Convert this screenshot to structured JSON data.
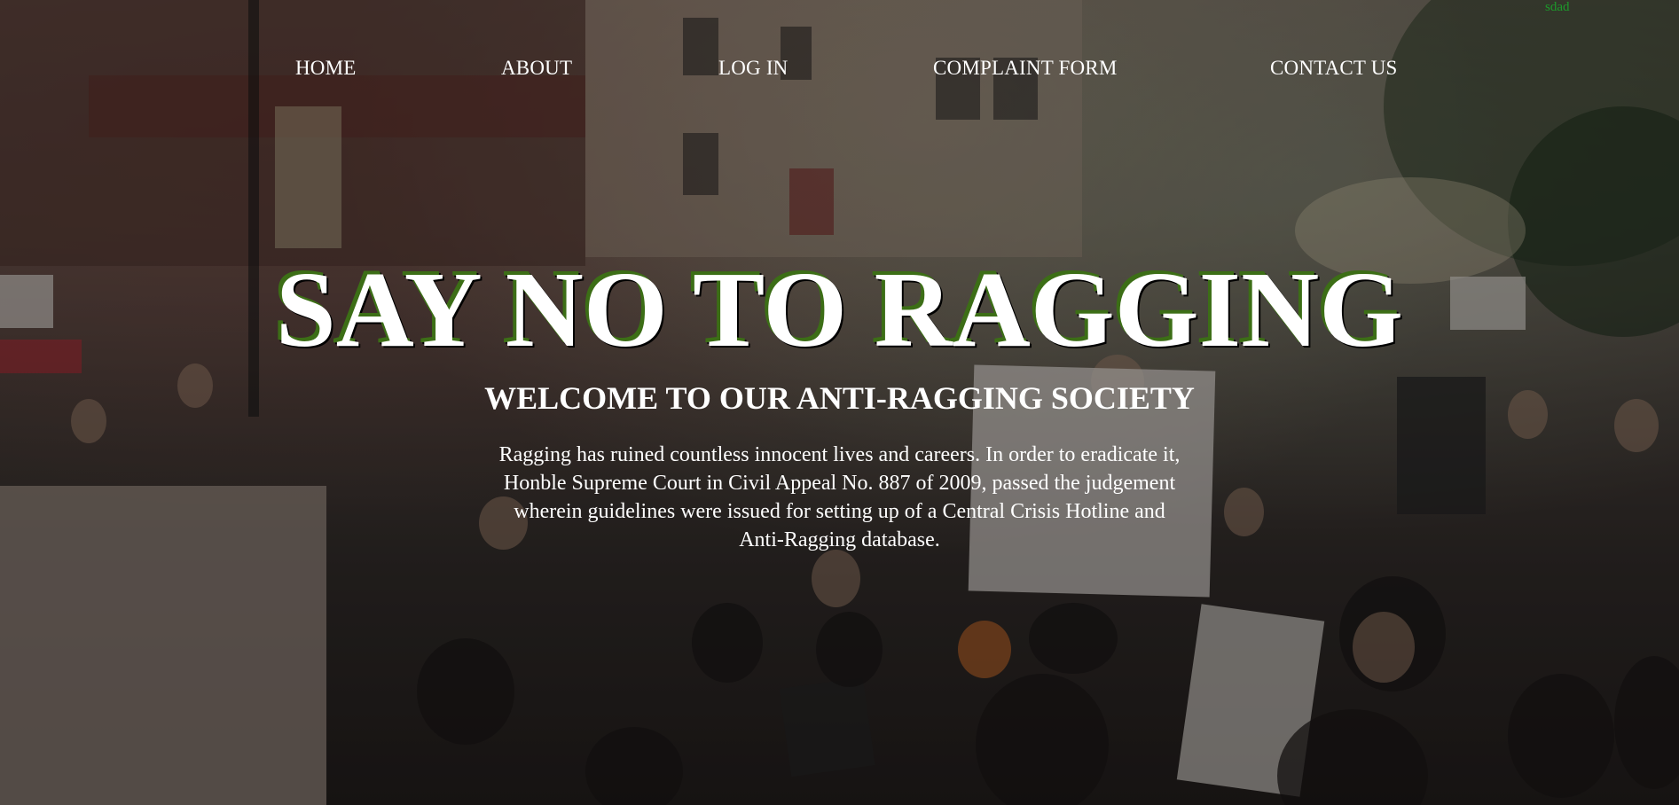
{
  "nav": {
    "items": [
      {
        "label": "HOME"
      },
      {
        "label": "ABOUT"
      },
      {
        "label": "LOG IN"
      },
      {
        "label": "COMPLAINT FORM"
      },
      {
        "label": "CONTACT US"
      }
    ]
  },
  "corner_text": "sdad",
  "hero": {
    "title": "SAY NO TO RAGGING",
    "subtitle": "WELCOME TO OUR ANTI-RAGGING SOCIETY",
    "intro": "Ragging has ruined countless innocent lives and careers. In order to eradicate it, Honble Supreme Court in Civil Appeal No. 887 of 2009, passed the judgement wherein guidelines were issued for setting up of a Central Crisis Hotline and Anti-Ragging database."
  },
  "colors": {
    "nav_text": "#ffffff",
    "title_text": "#ffffff",
    "title_shadow": "#3c6e16",
    "corner_text": "#1d9a2b"
  }
}
